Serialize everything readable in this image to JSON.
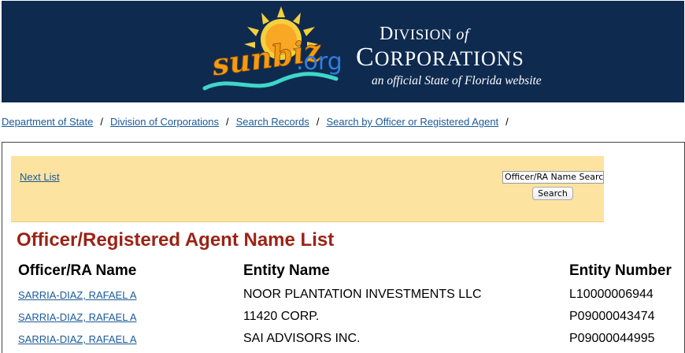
{
  "header": {
    "logo_text": "sunbiz.org",
    "division_word_big": "D",
    "division_word_rest": "IVISION",
    "division_of": "of",
    "corp_word_big": "C",
    "corp_word_rest": "ORPORATIONS",
    "tagline": "an official State of Florida website"
  },
  "breadcrumb": [
    {
      "label": "Department of State"
    },
    {
      "label": "Division of Corporations"
    },
    {
      "label": "Search Records"
    },
    {
      "label": "Search by Officer or Registered Agent"
    }
  ],
  "breadcrumb_separator": "/",
  "nav": {
    "next_list_label": "Next List",
    "search_input_value": "Officer/RA Name Search",
    "search_button_label": "Search"
  },
  "page_title": "Officer/Registered Agent Name List",
  "table": {
    "columns": [
      "Officer/RA Name",
      "Entity Name",
      "Entity Number"
    ],
    "rows": [
      {
        "officer": "SARRIA-DIAZ, RAFAEL A",
        "entity_name": "NOOR PLANTATION INVESTMENTS LLC",
        "entity_number": "L10000006944"
      },
      {
        "officer": "SARRIA-DIAZ, RAFAEL A",
        "entity_name": "11420 CORP.",
        "entity_number": "P09000043474"
      },
      {
        "officer": "SARRIA-DIAZ, RAFAEL A",
        "entity_name": "SAI ADVISORS INC.",
        "entity_number": "P09000044995"
      }
    ]
  },
  "colors": {
    "banner_bg": "#0e2a4f",
    "nav_panel_bg": "#fce3a0",
    "title_red": "#9b2316",
    "link_blue": "#1a5a9a"
  }
}
